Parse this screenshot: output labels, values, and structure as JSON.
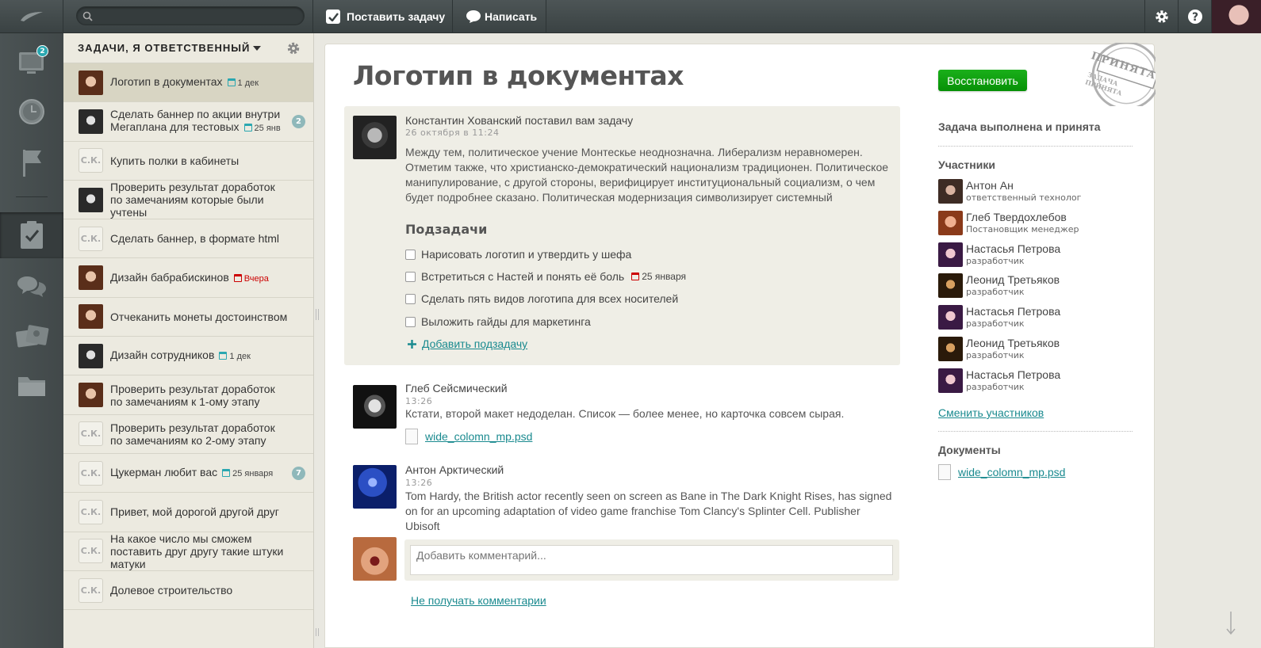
{
  "topbar": {
    "search_placeholder": "",
    "new_task_label": "Поставить задачу",
    "write_label": "Написать"
  },
  "nav": {
    "items": [
      {
        "name": "dashboard",
        "badge": "2"
      },
      {
        "name": "clock"
      },
      {
        "name": "flag"
      },
      {
        "name": "tasks"
      },
      {
        "name": "discussions"
      },
      {
        "name": "contacts"
      },
      {
        "name": "documents"
      }
    ]
  },
  "tasklist": {
    "header": "ЗАДАЧИ, Я ОТВЕТСТВЕННЫЙ",
    "tasks": [
      {
        "text": "Логотип в документах",
        "date": "1 дек",
        "avatar": "f1"
      },
      {
        "text": "Сделать баннер по акции внутри Мегаплана для тестовых",
        "date": "25 янв",
        "badge": "2",
        "avatar": "m1"
      },
      {
        "text": "Купить полки в кабинеты",
        "initials": "С.К."
      },
      {
        "text": "Проверить результат доработок по замечаниям которые были учтены",
        "avatar": "m1"
      },
      {
        "text": "Сделать баннер, в формате html",
        "initials": "С.К."
      },
      {
        "text": "Дизайн бабрабискинов",
        "date": "Вчера",
        "overdue": true,
        "avatar": "f1"
      },
      {
        "text": "Отчеканить монеты достоинством",
        "avatar": "f1"
      },
      {
        "text": "Дизайн сотрудников",
        "date": "1 дек",
        "avatar": "m1"
      },
      {
        "text": "Проверить результат доработок по замечаниям к 1-ому этапу",
        "avatar": "f1"
      },
      {
        "text": "Проверить результат доработок по замечаниям ко 2-ому этапу",
        "initials": "С.К."
      },
      {
        "text": "Цукерман любит вас",
        "date": "25 января",
        "badge": "7",
        "initials": "С.К."
      },
      {
        "text": "Привет, мой дорогой другой друг",
        "initials": "С.К."
      },
      {
        "text": "На какое число мы сможем поставить друг другу такие штуки матуки",
        "initials": "С.К."
      },
      {
        "text": "Долевое строительство",
        "initials": "С.К."
      }
    ]
  },
  "task": {
    "title": "Логотип в документах",
    "author_line": "Константин Хованский поставил вам задачу",
    "created": "26 октября в 11:24",
    "description": "Между тем, политическое учение Монтескье неоднозначна. Либерализм неравномерен. Отметим также, что христианско-демократический национализм традиционен. Политическое манипулирование, с другой стороны, верифицирует институциональный социализм, о чем будет подробнее сказано. Политическая модернизация символизирует системный",
    "subtasks_title": "Подзадачи",
    "subtasks": [
      {
        "text": "Нарисовать логотип и утвердить у шефа"
      },
      {
        "text": "Встретиться с Настей и понять её боль",
        "date": "25 января"
      },
      {
        "text": "Сделать пять видов логотипа для всех носителей"
      },
      {
        "text": "Выложить гайды для маркетинга"
      }
    ],
    "add_subtask": "Добавить подзадачу"
  },
  "comments": [
    {
      "author": "Глеб Сейсмический",
      "time": "13:26",
      "text": "Кстати, второй макет недоделан. Список — более менее, но карточка совсем сырая.",
      "file": "wide_colomn_mp.psd"
    },
    {
      "author": "Антон Арктический",
      "time": "13:26",
      "text": "Tom Hardy, the British actor recently seen on screen as Bane in The Dark Knight Rises, has signed on for an upcoming adaptation of video game franchise Tom Clancy's Splinter Cell. Publisher Ubisoft"
    }
  ],
  "comment_input": {
    "placeholder": "Добавить комментарий..."
  },
  "unsubscribe": "Не получать комментарии",
  "sidebar": {
    "restore_button": "Восстановить",
    "stamp_text": "ПРИНЯТА",
    "stamp_subtext": "ЗАДАЧА ПРИНЯТА",
    "status": "Задача выполнена и принята",
    "members_title": "Участники",
    "members": [
      {
        "name": "Антон Ан",
        "role": "ответственный технолог"
      },
      {
        "name": "Глеб Твердохлебов",
        "role": "Постановщик менеджер"
      },
      {
        "name": "Настасья Петрова",
        "role": "разработчик"
      },
      {
        "name": "Леонид Третьяков",
        "role": "разработчик"
      },
      {
        "name": "Настасья Петрова",
        "role": "разработчик"
      },
      {
        "name": "Леонид Третьяков",
        "role": "разработчик"
      },
      {
        "name": "Настасья Петрова",
        "role": "разработчик"
      }
    ],
    "change_members": "Сменить участников",
    "documents_title": "Документы",
    "document": "wide_colomn_mp.psd"
  },
  "colors": {
    "accent": "#1a8a8f",
    "green": "#0a9a0a",
    "badge": "#2aa7b0"
  }
}
